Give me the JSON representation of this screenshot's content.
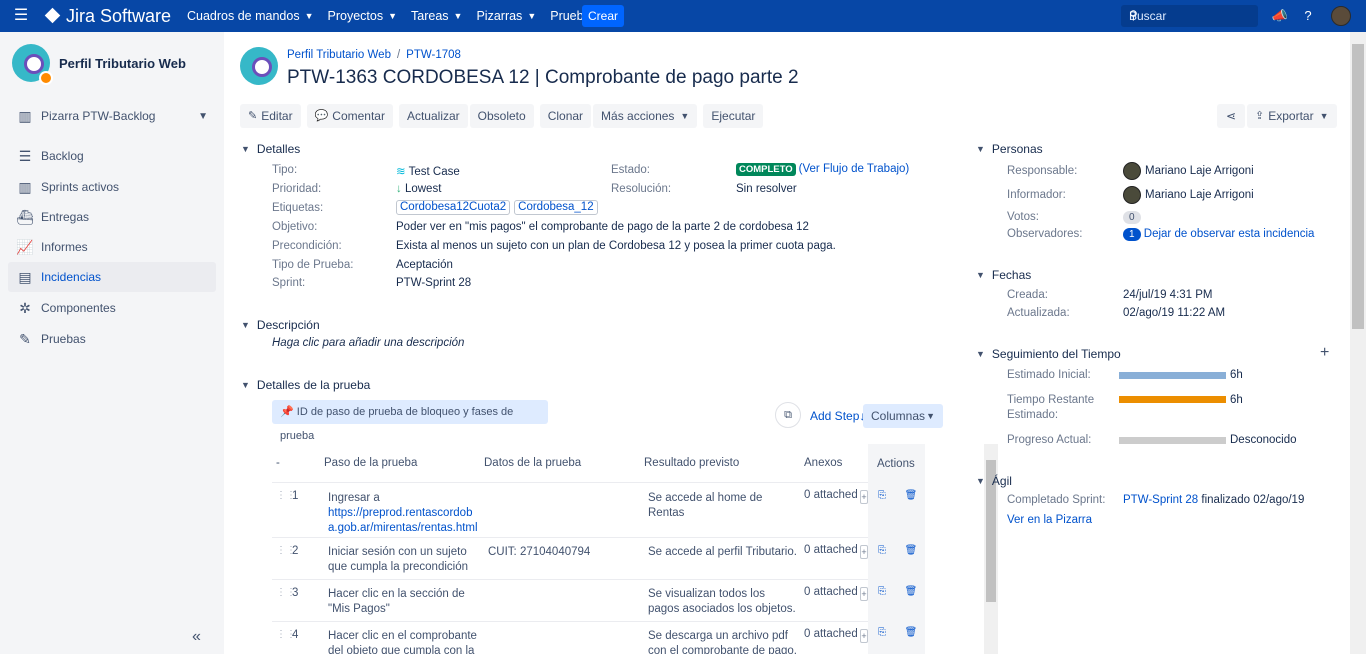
{
  "topbar": {
    "menu_icon": "hamburger-icon",
    "logo_text": "Jira Software",
    "nav": [
      {
        "label": "Cuadros de mandos"
      },
      {
        "label": "Proyectos"
      },
      {
        "label": "Tareas"
      },
      {
        "label": "Pizarras"
      },
      {
        "label": "Pruebas"
      }
    ],
    "create_label": "Crear",
    "search_placeholder": "Buscar",
    "accent": "#0747a6"
  },
  "sidebar": {
    "project_name": "Perfil Tributario Web",
    "board_selector": "Pizarra PTW-Backlog",
    "items": [
      {
        "label": "Backlog",
        "icon": "backlog-icon"
      },
      {
        "label": "Sprints activos",
        "icon": "board-icon"
      },
      {
        "label": "Entregas",
        "icon": "ship-icon"
      },
      {
        "label": "Informes",
        "icon": "chart-icon"
      },
      {
        "label": "Incidencias",
        "icon": "issues-icon"
      },
      {
        "label": "Componentes",
        "icon": "puzzle-icon"
      },
      {
        "label": "Pruebas",
        "icon": "test-icon"
      }
    ],
    "active_item": "Incidencias"
  },
  "issue": {
    "breadcrumb_project": "Perfil Tributario Web",
    "breadcrumb_sep": "/",
    "breadcrumb_parent": "PTW-1708",
    "title": "PTW-1363 CORDOBESA 12 | Comprobante de pago parte 2"
  },
  "toolbar": {
    "edit": "Editar",
    "comment": "Comentar",
    "update": "Actualizar",
    "obsolete": "Obsoleto",
    "clone": "Clonar",
    "more": "Más acciones",
    "execute": "Ejecutar",
    "export": "Exportar"
  },
  "details": {
    "heading": "Detalles",
    "type_label": "Tipo:",
    "type_value": "Test Case",
    "priority_label": "Prioridad:",
    "priority_value": "Lowest",
    "labels_label": "Etiquetas:",
    "labels": [
      "Cordobesa12Cuota2",
      "Cordobesa_12"
    ],
    "objective_label": "Objetivo:",
    "objective_value": "Poder ver en \"mis pagos\" el comprobante de pago de la parte 2 de cordobesa 12",
    "precondition_label": "Precondición:",
    "precondition_value": "Exista al menos un sujeto con un plan de Cordobesa 12 y posea la primer cuota paga.",
    "testtype_label": "Tipo de Prueba:",
    "testtype_value": "Aceptación",
    "sprint_label": "Sprint:",
    "sprint_value": "PTW-Sprint 28",
    "status_label": "Estado:",
    "status_value": "COMPLETO",
    "workflow_link": "(Ver Flujo de Trabajo)",
    "resolution_label": "Resolución:",
    "resolution_value": "Sin resolver",
    "status_color": "#00875a"
  },
  "description": {
    "heading": "Descripción",
    "placeholder": "Haga clic para añadir una descripción"
  },
  "test_details": {
    "heading": "Detalles de la prueba",
    "banner": "ID de paso de prueba de bloqueo y fases de prueba",
    "add_step": "Add Step",
    "columns_btn": "Columnas",
    "headers": {
      "dash": "-",
      "step": "Paso de la prueba",
      "data": "Datos de la prueba",
      "result": "Resultado previsto",
      "attachments": "Anexos",
      "actions": "Actions"
    },
    "steps": [
      {
        "num": "1",
        "step": "Ingresar a",
        "step_link": "https://preprod.rentascordoba.gob.ar/mirentas/rentas.html",
        "data": "",
        "result": "Se accede al home de Rentas",
        "attached": "0 attached"
      },
      {
        "num": "2",
        "step": "Iniciar sesión con un sujeto que cumpla la precondición",
        "data": "CUIT: 27104040794",
        "result": "Se accede al perfil Tributario.",
        "attached": "0 attached"
      },
      {
        "num": "3",
        "step": "Hacer clic en la sección de \"Mis Pagos\"",
        "data": "",
        "result": "Se visualizan todos los pagos asociados los objetos.",
        "attached": "0 attached"
      },
      {
        "num": "4",
        "step": "Hacer clic en el comprobante del objeto que cumpla con la",
        "data": "",
        "result": "Se descarga un archivo pdf con el comprobante de pago.",
        "attached": "0 attached"
      }
    ]
  },
  "people": {
    "heading": "Personas",
    "assignee_label": "Responsable:",
    "assignee": "Mariano Laje Arrigoni",
    "reporter_label": "Informador:",
    "reporter": "Mariano Laje Arrigoni",
    "votes_label": "Votos:",
    "votes": "0",
    "watchers_label": "Observadores:",
    "watchers": "1",
    "unwatch_link": "Dejar de observar esta incidencia"
  },
  "dates": {
    "heading": "Fechas",
    "created_label": "Creada:",
    "created": "24/jul/19 4:31 PM",
    "updated_label": "Actualizada:",
    "updated": "02/ago/19 11:22 AM"
  },
  "time_tracking": {
    "heading": "Seguimiento del Tiempo",
    "estimated_label": "Estimado Inicial:",
    "estimated": "6h",
    "remaining_label_1": "Tiempo Restante",
    "remaining_label_2": "Estimado:",
    "remaining": "6h",
    "progress_label": "Progreso Actual:",
    "progress": "Desconocido",
    "estimated_color": "#89afd7",
    "remaining_color": "#ec8e00",
    "progress_color": "#ccc"
  },
  "agile": {
    "heading": "Ágil",
    "completed_label": "Completado Sprint:",
    "sprint_link": "PTW-Sprint 28",
    "sprint_suffix": "finalizado 02/ago/19",
    "board_link": "Ver en la Pizarra"
  }
}
